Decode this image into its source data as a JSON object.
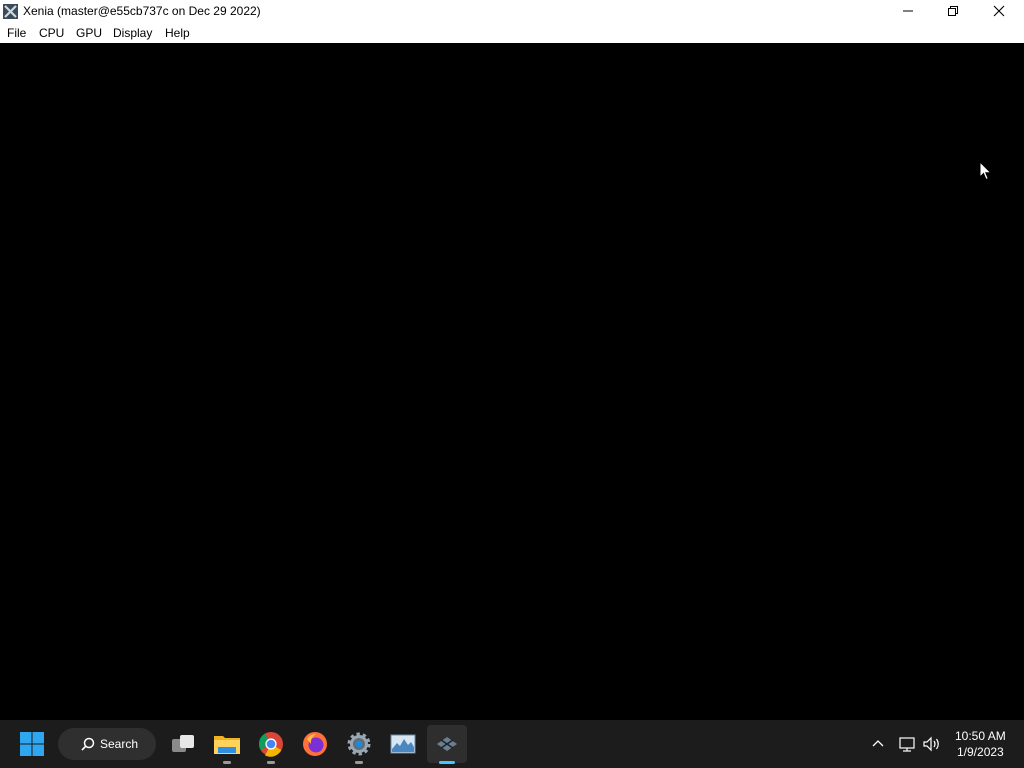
{
  "window": {
    "title": "Xenia (master@e55cb737c on Dec 29 2022)",
    "icon": "xenia-app-icon",
    "controls": {
      "minimize": "minimize-icon",
      "maximize": "restore-icon",
      "close": "close-icon"
    }
  },
  "menu": {
    "items": [
      {
        "label": "File"
      },
      {
        "label": "CPU"
      },
      {
        "label": "GPU"
      },
      {
        "label": "Display"
      },
      {
        "label": "Help"
      }
    ]
  },
  "taskbar": {
    "search_label": "Search",
    "apps": [
      {
        "icon": "windows-start-icon"
      },
      {
        "icon": "task-view-icon"
      },
      {
        "icon": "file-explorer-icon",
        "running": true
      },
      {
        "icon": "chrome-icon",
        "running": true
      },
      {
        "icon": "firefox-icon",
        "running": false
      },
      {
        "icon": "settings-gear-icon",
        "running": true
      },
      {
        "icon": "resource-monitor-icon",
        "running": false
      },
      {
        "icon": "xenia-taskbar-icon",
        "running": true,
        "active": true
      }
    ],
    "tray": {
      "icons": [
        "chevron-up-icon",
        "network-icon",
        "volume-icon"
      ],
      "time": "10:50 AM",
      "date": "1/9/2023"
    },
    "accent_color": "#4cc2ff"
  }
}
